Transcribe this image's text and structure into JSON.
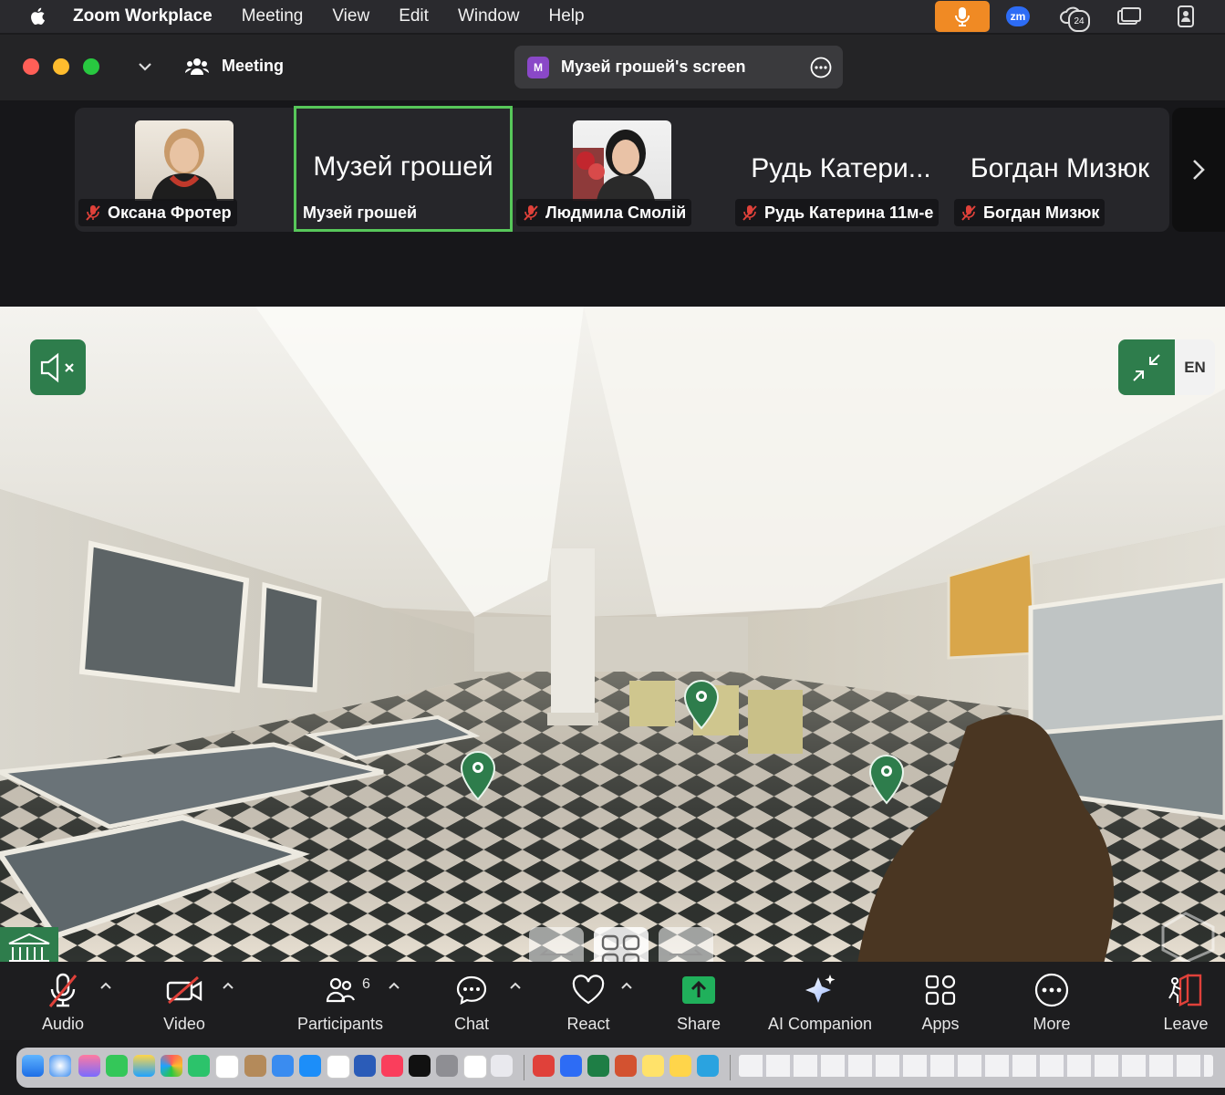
{
  "menubar": {
    "app": "Zoom Workplace",
    "items": [
      "Meeting",
      "View",
      "Edit",
      "Window",
      "Help"
    ],
    "zm": "zm",
    "calendar_badge": "24"
  },
  "window": {
    "meeting_label": "Meeting",
    "screen_share_initial": "M",
    "screen_share_label": "Музей грошей's screen"
  },
  "participants": [
    {
      "label": "Оксана Фротер",
      "has_photo": true,
      "muted": true
    },
    {
      "big_name": "Музей грошей",
      "label": "Музей грошей",
      "active": true,
      "muted": false
    },
    {
      "label": "Людмила Смолій",
      "has_photo": true,
      "muted": true
    },
    {
      "big_name": "Рудь Катери...",
      "label": "Рудь Катерина 11м-е",
      "muted": true
    },
    {
      "big_name": "Богдан Мизюк",
      "label": "Богдан Мизюк",
      "muted": true
    }
  ],
  "shared_screen": {
    "lang_label": "EN",
    "accent": "#2e7d4c"
  },
  "toolbar": {
    "audio": "Audio",
    "video": "Video",
    "participants": "Participants",
    "participants_count": "6",
    "chat": "Chat",
    "react": "React",
    "share": "Share",
    "ai": "AI Companion",
    "apps": "Apps",
    "more": "More",
    "leave": "Leave"
  },
  "colors": {
    "active_border": "#57c75a",
    "mute_red": "#e0413a",
    "share_green": "#20b05b",
    "leave_red": "#e0413a"
  }
}
